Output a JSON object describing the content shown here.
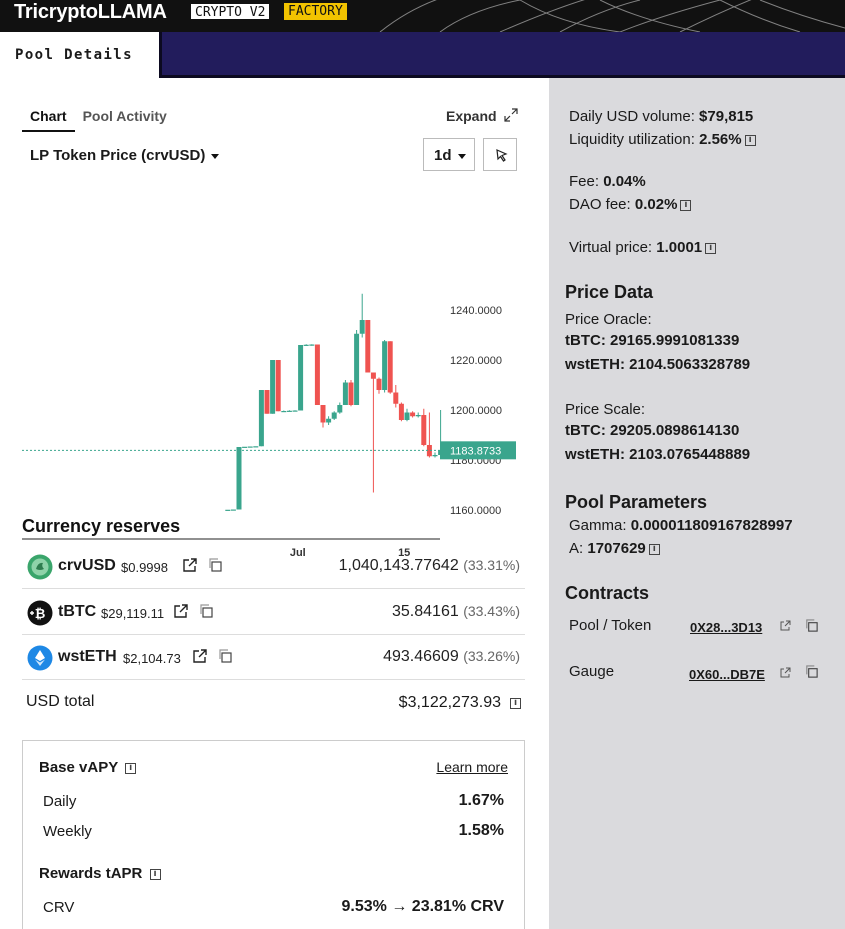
{
  "header": {
    "title": "TricryptoLLAMA",
    "badge_type": "CRYPTO V2",
    "badge_factory": "FACTORY"
  },
  "tabs": {
    "active": "Pool Details"
  },
  "chart_panel": {
    "tab_chart": "Chart",
    "tab_activity": "Pool Activity",
    "expand": "Expand",
    "selector": "LP Token Price (crvUSD)",
    "period": "1d"
  },
  "chart_data": {
    "type": "candlestick",
    "ylim": [
      1150,
      1250
    ],
    "yticks": [
      {
        "label": "1240.0000",
        "value": 1240
      },
      {
        "label": "1220.0000",
        "value": 1220
      },
      {
        "label": "1200.0000",
        "value": 1200
      },
      {
        "label": "1180.0000",
        "value": 1180
      },
      {
        "label": "1160.0000",
        "value": 1160
      }
    ],
    "xticks": [
      {
        "label": "Jul",
        "index": 13
      },
      {
        "label": "15",
        "index": 32
      }
    ],
    "current_price": 1183.8733,
    "current_price_label": "1183.8733",
    "candles": [
      {
        "o": 1160.0,
        "h": 1160.0,
        "l": 1160.0,
        "c": 1160.1
      },
      {
        "o": 1160.1,
        "h": 1160.1,
        "l": 1160.1,
        "c": 1160.2
      },
      {
        "o": 1160.2,
        "h": 1185.2,
        "l": 1160.2,
        "c": 1185.2
      },
      {
        "o": 1185.2,
        "h": 1185.2,
        "l": 1185.1,
        "c": 1185.3
      },
      {
        "o": 1185.3,
        "h": 1185.3,
        "l": 1185.2,
        "c": 1185.4
      },
      {
        "o": 1185.4,
        "h": 1185.4,
        "l": 1185.3,
        "c": 1185.5
      },
      {
        "o": 1185.5,
        "h": 1208.0,
        "l": 1185.5,
        "c": 1208.0
      },
      {
        "o": 1208.0,
        "h": 1208.0,
        "l": 1198.5,
        "c": 1198.5
      },
      {
        "o": 1198.5,
        "h": 1220.0,
        "l": 1198.5,
        "c": 1220.0
      },
      {
        "o": 1220.0,
        "h": 1220.0,
        "l": 1199.5,
        "c": 1199.5
      },
      {
        "o": 1199.5,
        "h": 1199.8,
        "l": 1199.3,
        "c": 1199.6
      },
      {
        "o": 1199.6,
        "h": 1199.9,
        "l": 1199.4,
        "c": 1199.7
      },
      {
        "o": 1199.7,
        "h": 1199.9,
        "l": 1199.5,
        "c": 1199.8
      },
      {
        "o": 1199.8,
        "h": 1226.0,
        "l": 1199.8,
        "c": 1226.0
      },
      {
        "o": 1226.0,
        "h": 1226.3,
        "l": 1225.7,
        "c": 1226.1
      },
      {
        "o": 1226.1,
        "h": 1226.3,
        "l": 1225.7,
        "c": 1226.2
      },
      {
        "o": 1226.2,
        "h": 1226.2,
        "l": 1202.0,
        "c": 1202.0
      },
      {
        "o": 1202.0,
        "h": 1202.0,
        "l": 1193.0,
        "c": 1195.0
      },
      {
        "o": 1195.0,
        "h": 1197.5,
        "l": 1194.0,
        "c": 1196.5
      },
      {
        "o": 1196.5,
        "h": 1199.5,
        "l": 1196.0,
        "c": 1199.0
      },
      {
        "o": 1199.0,
        "h": 1203.0,
        "l": 1198.5,
        "c": 1202.0
      },
      {
        "o": 1202.0,
        "h": 1212.0,
        "l": 1202.0,
        "c": 1211.0
      },
      {
        "o": 1211.0,
        "h": 1212.0,
        "l": 1201.5,
        "c": 1202.0
      },
      {
        "o": 1202.0,
        "h": 1232.0,
        "l": 1202.0,
        "c": 1230.5
      },
      {
        "o": 1230.5,
        "h": 1246.5,
        "l": 1229.0,
        "c": 1236.0
      },
      {
        "o": 1236.0,
        "h": 1236.0,
        "l": 1215.0,
        "c": 1215.0
      },
      {
        "o": 1215.0,
        "h": 1215.0,
        "l": 1167.0,
        "c": 1212.5
      },
      {
        "o": 1212.5,
        "h": 1213.0,
        "l": 1206.5,
        "c": 1208.0
      },
      {
        "o": 1208.0,
        "h": 1228.0,
        "l": 1207.0,
        "c": 1227.5
      },
      {
        "o": 1227.5,
        "h": 1227.5,
        "l": 1206.5,
        "c": 1207.0
      },
      {
        "o": 1207.0,
        "h": 1210.0,
        "l": 1201.0,
        "c": 1202.5
      },
      {
        "o": 1202.5,
        "h": 1203.0,
        "l": 1195.5,
        "c": 1196.0
      },
      {
        "o": 1196.0,
        "h": 1200.5,
        "l": 1195.5,
        "c": 1199.0
      },
      {
        "o": 1199.0,
        "h": 1199.5,
        "l": 1197.0,
        "c": 1197.5
      },
      {
        "o": 1197.5,
        "h": 1199.0,
        "l": 1197.0,
        "c": 1198.0
      },
      {
        "o": 1198.0,
        "h": 1200.5,
        "l": 1185.5,
        "c": 1186.0
      },
      {
        "o": 1186.0,
        "h": 1199.0,
        "l": 1181.0,
        "c": 1181.5
      },
      {
        "o": 1181.5,
        "h": 1183.0,
        "l": 1181.0,
        "c": 1182.0
      },
      {
        "o": 1182.0,
        "h": 1200.0,
        "l": 1181.5,
        "c": 1183.8733
      }
    ]
  },
  "reserves": {
    "title": "Currency reserves",
    "items": [
      {
        "name": "crvUSD",
        "price": "$0.9998",
        "amount": "1,040,143.77642",
        "pct": "(33.31%)",
        "color": "#3aa56b"
      },
      {
        "name": "tBTC",
        "price": "$29,119.11",
        "amount": "35.84161",
        "pct": "(33.43%)",
        "color": "#111111"
      },
      {
        "name": "wstETH",
        "price": "$2,104.73",
        "amount": "493.46609",
        "pct": "(33.26%)",
        "color": "#1e88e5"
      }
    ],
    "total_label": "USD total",
    "total_value": "$3,122,273.93"
  },
  "apy": {
    "base_title": "Base vAPY",
    "learn_more": "Learn more",
    "daily_label": "Daily",
    "daily_value": "1.67%",
    "weekly_label": "Weekly",
    "weekly_value": "1.58%",
    "rewards_title": "Rewards tAPR",
    "crv_label": "CRV",
    "crv_value": "9.53% → 23.81% CRV"
  },
  "stats": {
    "volume_label": "Daily USD volume:",
    "volume_value": "$79,815",
    "util_label": "Liquidity utilization:",
    "util_value": "2.56%",
    "fee_label": "Fee:",
    "fee_value": "0.04%",
    "dao_label": "DAO fee:",
    "dao_value": "0.02%",
    "virtual_label": "Virtual price:",
    "virtual_value": "1.0001"
  },
  "price_data": {
    "title": "Price Data",
    "oracle_label": "Price Oracle:",
    "oracle_tbtc": "tBTC: 29165.9991081339",
    "oracle_wsteth": "wstETH: 2104.5063328789",
    "scale_label": "Price Scale:",
    "scale_tbtc": "tBTC: 29205.0898614130",
    "scale_wsteth": "wstETH: 2103.0765448889"
  },
  "params": {
    "title": "Pool Parameters",
    "gamma_label": "Gamma:",
    "gamma_value": "0.000011809167828997",
    "a_label": "A:",
    "a_value": "1707629"
  },
  "contracts": {
    "title": "Contracts",
    "pool_label": "Pool / Token",
    "pool_addr": "0X28...3D13",
    "gauge_label": "Gauge",
    "gauge_addr": "0X60...DB7E"
  },
  "colors": {
    "up": "#3aa58d",
    "down": "#ef5350",
    "nav": "#221c5c",
    "panel": "#dadadd",
    "badge_factory": "#f2c300"
  }
}
